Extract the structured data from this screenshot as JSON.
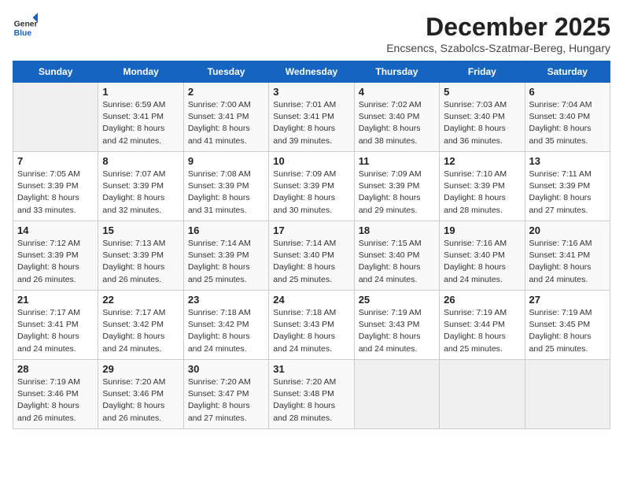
{
  "header": {
    "logo_general": "General",
    "logo_blue": "Blue",
    "month": "December 2025",
    "location": "Encsencs, Szabolcs-Szatmar-Bereg, Hungary"
  },
  "weekdays": [
    "Sunday",
    "Monday",
    "Tuesday",
    "Wednesday",
    "Thursday",
    "Friday",
    "Saturday"
  ],
  "weeks": [
    [
      {
        "day": "",
        "info": ""
      },
      {
        "day": "1",
        "info": "Sunrise: 6:59 AM\nSunset: 3:41 PM\nDaylight: 8 hours\nand 42 minutes."
      },
      {
        "day": "2",
        "info": "Sunrise: 7:00 AM\nSunset: 3:41 PM\nDaylight: 8 hours\nand 41 minutes."
      },
      {
        "day": "3",
        "info": "Sunrise: 7:01 AM\nSunset: 3:41 PM\nDaylight: 8 hours\nand 39 minutes."
      },
      {
        "day": "4",
        "info": "Sunrise: 7:02 AM\nSunset: 3:40 PM\nDaylight: 8 hours\nand 38 minutes."
      },
      {
        "day": "5",
        "info": "Sunrise: 7:03 AM\nSunset: 3:40 PM\nDaylight: 8 hours\nand 36 minutes."
      },
      {
        "day": "6",
        "info": "Sunrise: 7:04 AM\nSunset: 3:40 PM\nDaylight: 8 hours\nand 35 minutes."
      }
    ],
    [
      {
        "day": "7",
        "info": "Sunrise: 7:05 AM\nSunset: 3:39 PM\nDaylight: 8 hours\nand 33 minutes."
      },
      {
        "day": "8",
        "info": "Sunrise: 7:07 AM\nSunset: 3:39 PM\nDaylight: 8 hours\nand 32 minutes."
      },
      {
        "day": "9",
        "info": "Sunrise: 7:08 AM\nSunset: 3:39 PM\nDaylight: 8 hours\nand 31 minutes."
      },
      {
        "day": "10",
        "info": "Sunrise: 7:09 AM\nSunset: 3:39 PM\nDaylight: 8 hours\nand 30 minutes."
      },
      {
        "day": "11",
        "info": "Sunrise: 7:09 AM\nSunset: 3:39 PM\nDaylight: 8 hours\nand 29 minutes."
      },
      {
        "day": "12",
        "info": "Sunrise: 7:10 AM\nSunset: 3:39 PM\nDaylight: 8 hours\nand 28 minutes."
      },
      {
        "day": "13",
        "info": "Sunrise: 7:11 AM\nSunset: 3:39 PM\nDaylight: 8 hours\nand 27 minutes."
      }
    ],
    [
      {
        "day": "14",
        "info": "Sunrise: 7:12 AM\nSunset: 3:39 PM\nDaylight: 8 hours\nand 26 minutes."
      },
      {
        "day": "15",
        "info": "Sunrise: 7:13 AM\nSunset: 3:39 PM\nDaylight: 8 hours\nand 26 minutes."
      },
      {
        "day": "16",
        "info": "Sunrise: 7:14 AM\nSunset: 3:39 PM\nDaylight: 8 hours\nand 25 minutes."
      },
      {
        "day": "17",
        "info": "Sunrise: 7:14 AM\nSunset: 3:40 PM\nDaylight: 8 hours\nand 25 minutes."
      },
      {
        "day": "18",
        "info": "Sunrise: 7:15 AM\nSunset: 3:40 PM\nDaylight: 8 hours\nand 24 minutes."
      },
      {
        "day": "19",
        "info": "Sunrise: 7:16 AM\nSunset: 3:40 PM\nDaylight: 8 hours\nand 24 minutes."
      },
      {
        "day": "20",
        "info": "Sunrise: 7:16 AM\nSunset: 3:41 PM\nDaylight: 8 hours\nand 24 minutes."
      }
    ],
    [
      {
        "day": "21",
        "info": "Sunrise: 7:17 AM\nSunset: 3:41 PM\nDaylight: 8 hours\nand 24 minutes."
      },
      {
        "day": "22",
        "info": "Sunrise: 7:17 AM\nSunset: 3:42 PM\nDaylight: 8 hours\nand 24 minutes."
      },
      {
        "day": "23",
        "info": "Sunrise: 7:18 AM\nSunset: 3:42 PM\nDaylight: 8 hours\nand 24 minutes."
      },
      {
        "day": "24",
        "info": "Sunrise: 7:18 AM\nSunset: 3:43 PM\nDaylight: 8 hours\nand 24 minutes."
      },
      {
        "day": "25",
        "info": "Sunrise: 7:19 AM\nSunset: 3:43 PM\nDaylight: 8 hours\nand 24 minutes."
      },
      {
        "day": "26",
        "info": "Sunrise: 7:19 AM\nSunset: 3:44 PM\nDaylight: 8 hours\nand 25 minutes."
      },
      {
        "day": "27",
        "info": "Sunrise: 7:19 AM\nSunset: 3:45 PM\nDaylight: 8 hours\nand 25 minutes."
      }
    ],
    [
      {
        "day": "28",
        "info": "Sunrise: 7:19 AM\nSunset: 3:46 PM\nDaylight: 8 hours\nand 26 minutes."
      },
      {
        "day": "29",
        "info": "Sunrise: 7:20 AM\nSunset: 3:46 PM\nDaylight: 8 hours\nand 26 minutes."
      },
      {
        "day": "30",
        "info": "Sunrise: 7:20 AM\nSunset: 3:47 PM\nDaylight: 8 hours\nand 27 minutes."
      },
      {
        "day": "31",
        "info": "Sunrise: 7:20 AM\nSunset: 3:48 PM\nDaylight: 8 hours\nand 28 minutes."
      },
      {
        "day": "",
        "info": ""
      },
      {
        "day": "",
        "info": ""
      },
      {
        "day": "",
        "info": ""
      }
    ]
  ]
}
